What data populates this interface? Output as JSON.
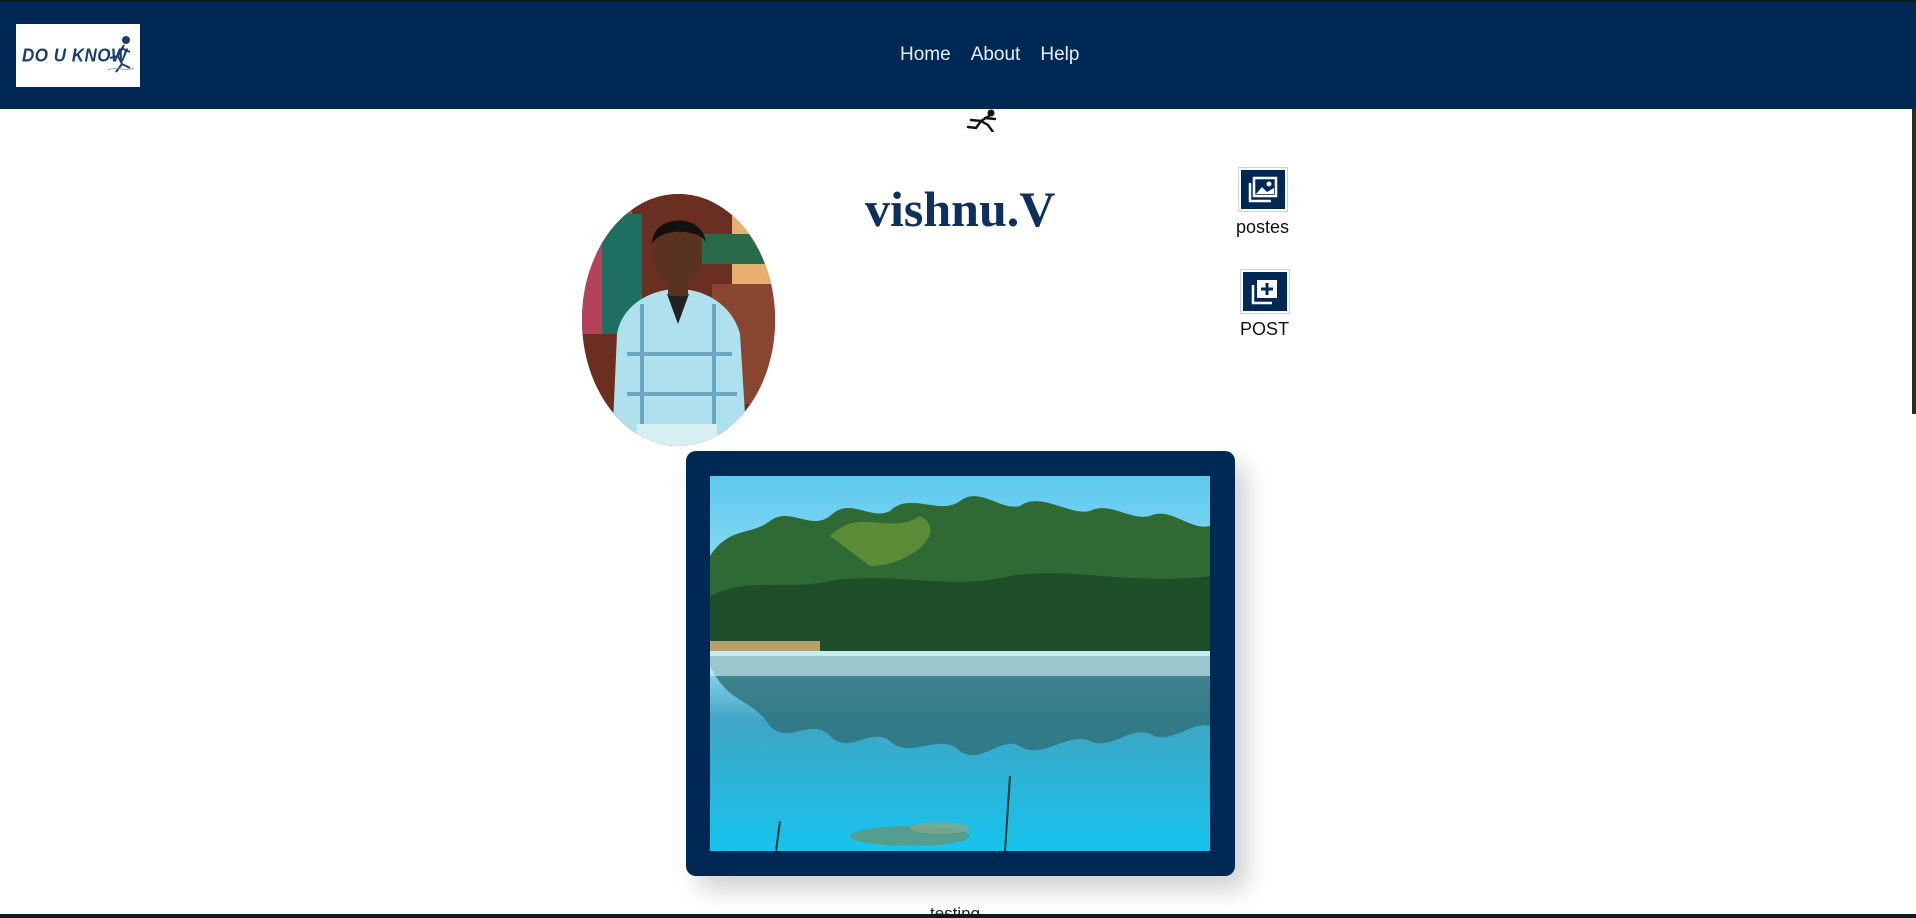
{
  "brand": {
    "logo_text": "DO U KNOW"
  },
  "nav": {
    "items": [
      {
        "label": "Home"
      },
      {
        "label": "About"
      },
      {
        "label": "Help"
      }
    ]
  },
  "profile": {
    "name": "vishnu.V"
  },
  "actions": {
    "posts_label": "postes",
    "new_post_label": "POST"
  },
  "post": {
    "caption": "testing"
  },
  "colors": {
    "navbar": "#002855",
    "accent_text": "#0f2f5c",
    "card": "#002855"
  }
}
